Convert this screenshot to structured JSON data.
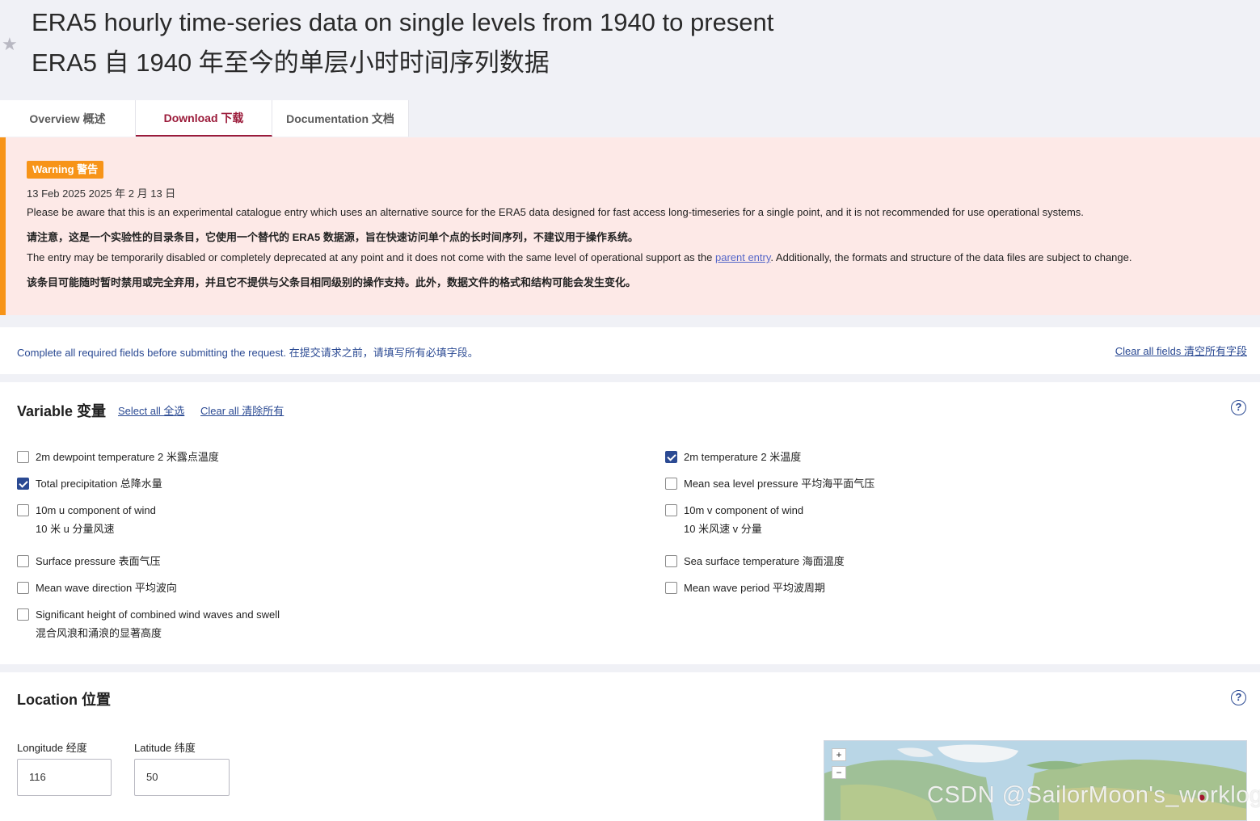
{
  "header": {
    "title_en": "ERA5 hourly time-series data on single levels from 1940 to present",
    "title_zh": "ERA5 自 1940 年至今的单层小时时间序列数据"
  },
  "tabs": [
    {
      "label": "Overview  概述"
    },
    {
      "label": "Download  下载"
    },
    {
      "label": "Documentation  文档"
    }
  ],
  "warning": {
    "badge": "Warning  警告",
    "date": "13 Feb 2025  2025 年 2 月 13 日",
    "line1": "Please be aware that this is an experimental catalogue entry which uses an alternative source for the ERA5 data designed for fast access long-timeseries for a single point, and it is not recommended for use operational systems.",
    "line2": "请注意，这是一个实验性的目录条目，它使用一个替代的 ERA5 数据源，旨在快速访问单个点的长时间序列，不建议用于操作系统。",
    "line3_pre": "The entry may be temporarily disabled or completely deprecated at any point and it does not come with the same level of operational support as the ",
    "line3_link": "parent entry",
    "line3_post": ". Additionally, the formats and structure of the data files are subject to change.",
    "line4": "该条目可能随时暂时禁用或完全弃用，并且它不提供与父条目相同级别的操作支持。此外，数据文件的格式和结构可能会发生变化。"
  },
  "infobar": {
    "text": "Complete all required fields before submitting the request.  在提交请求之前，请填写所有必填字段。",
    "clear_fields": "Clear all fields  清空所有字段"
  },
  "variable": {
    "title": "Variable  变量",
    "select_all": "Select all  全选",
    "clear_all": "Clear all  清除所有",
    "help": "?",
    "items": [
      {
        "label": "2m dewpoint temperature  2 米露点温度",
        "checked": false
      },
      {
        "label": "2m temperature  2 米温度",
        "checked": true
      },
      {
        "label": "Total precipitation  总降水量",
        "checked": true
      },
      {
        "label": "Mean sea level pressure  平均海平面气压",
        "checked": false
      },
      {
        "label": "10m u component of wind",
        "label2": "10 米 u 分量风速",
        "checked": false
      },
      {
        "label": "10m v component of wind",
        "label2": "10 米风速 v 分量",
        "checked": false
      },
      {
        "label": "Surface pressure  表面气压",
        "checked": false
      },
      {
        "label": "Sea surface temperature  海面温度",
        "checked": false
      },
      {
        "label": "Mean wave direction  平均波向",
        "checked": false
      },
      {
        "label": "Mean wave period  平均波周期",
        "checked": false
      },
      {
        "label": "Significant height of combined wind waves and swell",
        "label2": "混合风浪和涌浪的显著高度",
        "checked": false
      }
    ]
  },
  "location": {
    "title": "Location  位置",
    "help": "?",
    "longitude_label": "Longitude  经度",
    "longitude_value": "116",
    "latitude_label": "Latitude  纬度",
    "latitude_value": "50",
    "zoom_in": "+",
    "zoom_out": "−"
  },
  "watermark": "CSDN @SailorMoon's_worklog",
  "colors": {
    "accent": "#9b1b3a",
    "link": "#2b4a93",
    "warning": "#f79418",
    "warning_bg": "#fde9e7"
  }
}
